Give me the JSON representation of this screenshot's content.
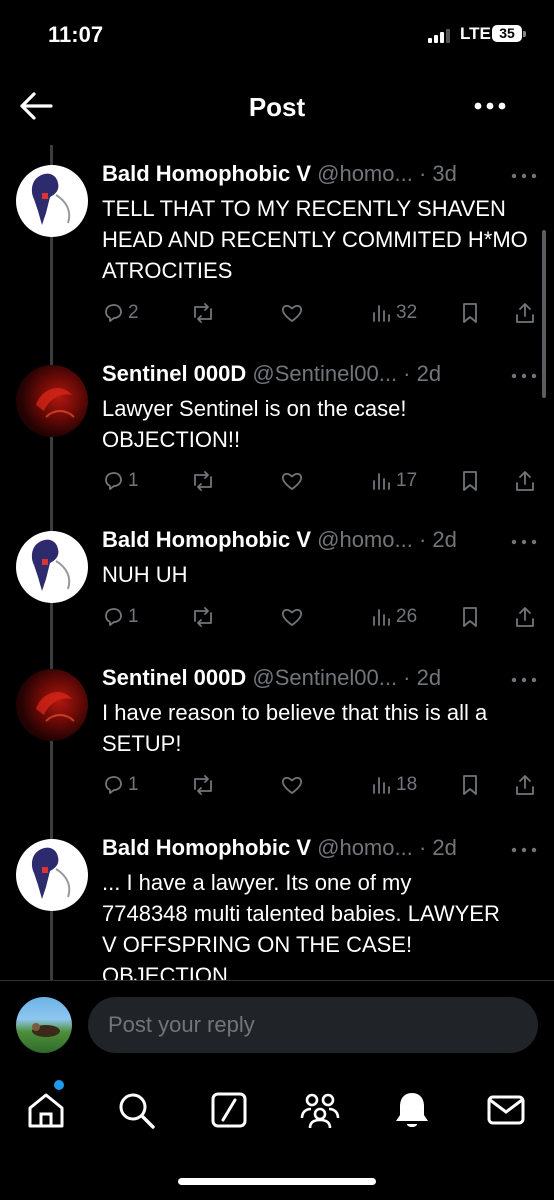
{
  "status": {
    "time": "11:07",
    "network": "LTE",
    "battery": "35"
  },
  "nav": {
    "title": "Post"
  },
  "posts": [
    {
      "name": "Bald Homophobic V",
      "meta": "@homo... · 3d",
      "text": "TELL THAT TO MY RECENTLY SHAVEN HEAD AND RECENTLY COMMITED H*MO ATROCITIES",
      "replies": "2",
      "reposts": "",
      "likes": "",
      "views": "32"
    },
    {
      "name": "Sentinel 000D",
      "meta": "@Sentinel00... · 2d",
      "text": "Lawyer Sentinel is on the case! OBJECTION!!",
      "replies": "1",
      "reposts": "",
      "likes": "",
      "views": "17"
    },
    {
      "name": "Bald Homophobic V",
      "meta": "@homo... · 2d",
      "text": "NUH UH",
      "replies": "1",
      "reposts": "",
      "likes": "",
      "views": "26"
    },
    {
      "name": "Sentinel 000D",
      "meta": "@Sentinel00... · 2d",
      "text": "I have reason to believe that this is all a SETUP!",
      "replies": "1",
      "reposts": "",
      "likes": "",
      "views": "18"
    },
    {
      "name": "Bald Homophobic V",
      "meta": "@homo... · 2d",
      "text": "... I have a lawyer. Its one of my 7748348 multi talented babies. LAWYER V OFFSPRING ON THE CASE! OBJECTION",
      "replies": "",
      "reposts": "",
      "likes": "",
      "views": ""
    }
  ],
  "reply": {
    "placeholder": "Post your reply"
  },
  "tabs": [
    "home-icon",
    "search-icon",
    "grok-icon",
    "communities-icon",
    "notifications-icon",
    "messages-icon"
  ],
  "colors": {
    "background": "#000000",
    "muted": "#71767b",
    "accent": "#1d9bf0",
    "input": "#202327"
  }
}
